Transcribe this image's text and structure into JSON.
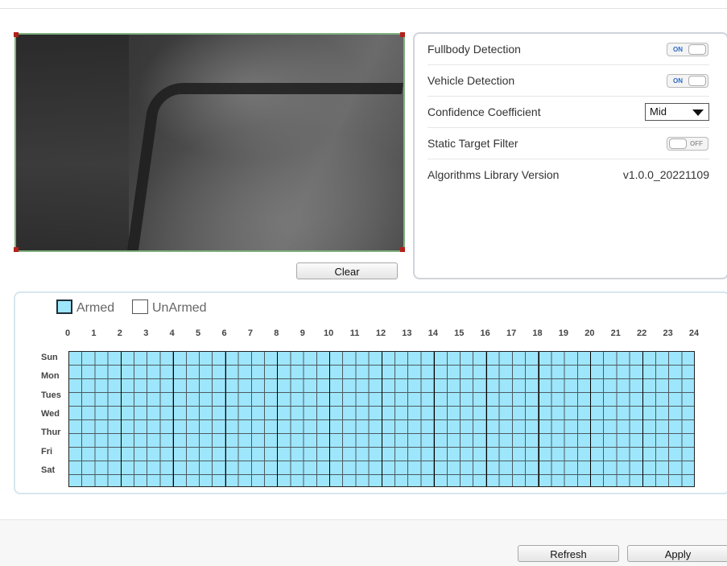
{
  "preview": {
    "clear_label": "Clear"
  },
  "settings": {
    "fullbody": {
      "label": "Fullbody Detection",
      "state": "ON"
    },
    "vehicle": {
      "label": "Vehicle Detection",
      "state": "ON"
    },
    "confidence": {
      "label": "Confidence Coefficient",
      "value": "Mid"
    },
    "static_filter": {
      "label": "Static Target Filter",
      "state": "OFF"
    },
    "library": {
      "label": "Algorithms Library Version",
      "value": "v1.0.0_20221109"
    }
  },
  "schedule": {
    "legend_armed": "Armed",
    "legend_unarmed": "UnArmed",
    "armed_color": "#9ee6fb",
    "hours": [
      "0",
      "1",
      "2",
      "3",
      "4",
      "5",
      "6",
      "7",
      "8",
      "9",
      "10",
      "11",
      "12",
      "13",
      "14",
      "15",
      "16",
      "17",
      "18",
      "19",
      "20",
      "21",
      "22",
      "23",
      "24"
    ],
    "days": [
      "Sun",
      "Mon",
      "Tues",
      "Wed",
      "Thur",
      "Fri",
      "Sat"
    ]
  },
  "footer": {
    "refresh_label": "Refresh",
    "apply_label": "Apply"
  }
}
